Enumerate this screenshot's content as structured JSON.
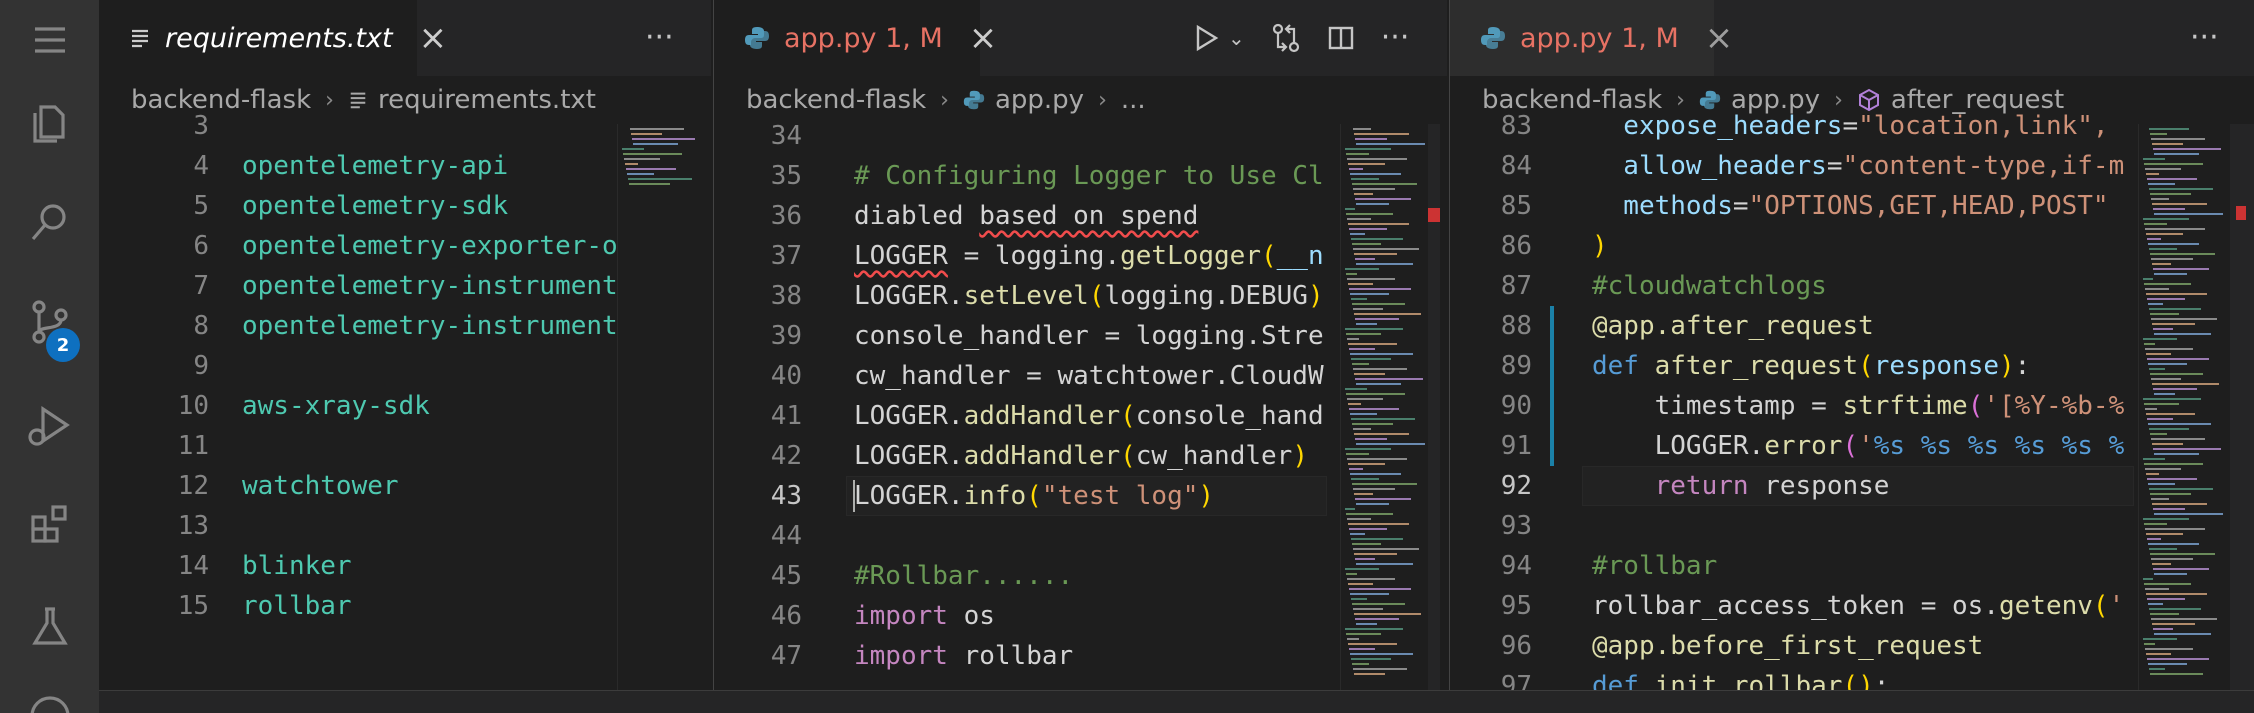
{
  "activity": {
    "items": [
      "explorer-icon",
      "search-icon",
      "source-control-icon",
      "run-debug-icon",
      "extensions-icon",
      "testing-icon"
    ],
    "scm_badge": "2"
  },
  "group1": {
    "tab_label": "requirements.txt",
    "breadcrumb": [
      "backend-flask",
      "requirements.txt"
    ],
    "lines": [
      {
        "n": "3",
        "t": ""
      },
      {
        "n": "4",
        "t": "opentelemetry-api"
      },
      {
        "n": "5",
        "t": "opentelemetry-sdk"
      },
      {
        "n": "6",
        "t": "opentelemetry-exporter-o"
      },
      {
        "n": "7",
        "t": "opentelemetry-instrument"
      },
      {
        "n": "8",
        "t": "opentelemetry-instrument"
      },
      {
        "n": "9",
        "t": ""
      },
      {
        "n": "10",
        "t": "aws-xray-sdk"
      },
      {
        "n": "11",
        "t": ""
      },
      {
        "n": "12",
        "t": "watchtower"
      },
      {
        "n": "13",
        "t": ""
      },
      {
        "n": "14",
        "t": "blinker"
      },
      {
        "n": "15",
        "t": "rollbar"
      }
    ]
  },
  "group2": {
    "tab_label": "app.py 1, M",
    "breadcrumb": [
      "backend-flask",
      "app.py",
      "..."
    ],
    "lines": [
      {
        "n": "34",
        "p": []
      },
      {
        "n": "35",
        "p": [
          {
            "c": "c-comment",
            "t": "# Configuring Logger to Use Cl"
          }
        ]
      },
      {
        "n": "36",
        "p": [
          {
            "c": "c-white",
            "t": "diabled "
          },
          {
            "c": "c-white squig",
            "t": "based on spend"
          }
        ]
      },
      {
        "n": "37",
        "p": [
          {
            "c": "c-white squig",
            "t": "LOGGER"
          },
          {
            "c": "c-white",
            "t": " = logging."
          },
          {
            "c": "c-fn",
            "t": "getLogger"
          },
          {
            "c": "c-yel",
            "t": "("
          },
          {
            "c": "c-var",
            "t": "__n"
          }
        ]
      },
      {
        "n": "38",
        "p": [
          {
            "c": "c-white",
            "t": "LOGGER."
          },
          {
            "c": "c-fn",
            "t": "setLevel"
          },
          {
            "c": "c-yel",
            "t": "("
          },
          {
            "c": "c-white",
            "t": "logging.DEBUG"
          },
          {
            "c": "c-yel",
            "t": ")"
          }
        ]
      },
      {
        "n": "39",
        "p": [
          {
            "c": "c-white",
            "t": "console_handler = logging.Stre"
          }
        ]
      },
      {
        "n": "40",
        "p": [
          {
            "c": "c-white",
            "t": "cw_handler = watchtower.CloudW"
          }
        ]
      },
      {
        "n": "41",
        "p": [
          {
            "c": "c-white",
            "t": "LOGGER."
          },
          {
            "c": "c-fn",
            "t": "addHandler"
          },
          {
            "c": "c-yel",
            "t": "("
          },
          {
            "c": "c-white",
            "t": "console_hand"
          }
        ]
      },
      {
        "n": "42",
        "p": [
          {
            "c": "c-white",
            "t": "LOGGER."
          },
          {
            "c": "c-fn",
            "t": "addHandler"
          },
          {
            "c": "c-yel",
            "t": "("
          },
          {
            "c": "c-white",
            "t": "cw_handler"
          },
          {
            "c": "c-yel",
            "t": ")"
          }
        ]
      },
      {
        "n": "43",
        "p": [
          {
            "c": "c-white",
            "t": "LOGGER."
          },
          {
            "c": "c-fn",
            "t": "info"
          },
          {
            "c": "c-yel",
            "t": "("
          },
          {
            "c": "c-str",
            "t": "\"test log\""
          },
          {
            "c": "c-yel",
            "t": ")"
          }
        ]
      },
      {
        "n": "44",
        "p": []
      },
      {
        "n": "45",
        "p": [
          {
            "c": "c-comment",
            "t": "#Rollbar......"
          }
        ]
      },
      {
        "n": "46",
        "p": [
          {
            "c": "c-kw",
            "t": "import"
          },
          {
            "c": "c-white",
            "t": " os"
          }
        ]
      },
      {
        "n": "47",
        "p": [
          {
            "c": "c-kw",
            "t": "import"
          },
          {
            "c": "c-white",
            "t": " rollbar"
          }
        ]
      }
    ]
  },
  "group3": {
    "tab_label": "app.py 1, M",
    "breadcrumb": [
      "backend-flask",
      "app.py",
      "after_request"
    ],
    "lines": [
      {
        "n": "83",
        "p": [
          {
            "c": "c-var",
            "t": "  expose_headers"
          },
          {
            "c": "c-white",
            "t": "="
          },
          {
            "c": "c-str",
            "t": "\"location,link\","
          }
        ]
      },
      {
        "n": "84",
        "p": [
          {
            "c": "c-var",
            "t": "  allow_headers"
          },
          {
            "c": "c-white",
            "t": "="
          },
          {
            "c": "c-str",
            "t": "\"content-type,if-m"
          }
        ]
      },
      {
        "n": "85",
        "p": [
          {
            "c": "c-var",
            "t": "  methods"
          },
          {
            "c": "c-white",
            "t": "="
          },
          {
            "c": "c-str",
            "t": "\"OPTIONS,GET,HEAD,POST\""
          }
        ]
      },
      {
        "n": "86",
        "p": [
          {
            "c": "c-yel",
            "t": ")"
          }
        ]
      },
      {
        "n": "87",
        "p": [
          {
            "c": "c-comment",
            "t": "#cloudwatchlogs"
          }
        ]
      },
      {
        "n": "88",
        "p": [
          {
            "c": "c-fn",
            "t": "@app.after_request"
          }
        ]
      },
      {
        "n": "89",
        "p": [
          {
            "c": "c-blue",
            "t": "def"
          },
          {
            "c": "c-white",
            "t": " "
          },
          {
            "c": "c-fn",
            "t": "after_request"
          },
          {
            "c": "c-yel",
            "t": "("
          },
          {
            "c": "c-var",
            "t": "response"
          },
          {
            "c": "c-yel",
            "t": ")"
          },
          {
            "c": "c-white",
            "t": ":"
          }
        ]
      },
      {
        "n": "90",
        "p": [
          {
            "c": "c-white",
            "t": "    timestamp = "
          },
          {
            "c": "c-fn",
            "t": "strftime"
          },
          {
            "c": "c-pur",
            "t": "("
          },
          {
            "c": "c-str",
            "t": "'[%Y-%b-%"
          }
        ]
      },
      {
        "n": "91",
        "p": [
          {
            "c": "c-white",
            "t": "    LOGGER."
          },
          {
            "c": "c-fn",
            "t": "error"
          },
          {
            "c": "c-pur",
            "t": "("
          },
          {
            "c": "c-str",
            "t": "'"
          },
          {
            "c": "c-esc",
            "t": "%s %s %s %s %s %"
          }
        ]
      },
      {
        "n": "92",
        "p": [
          {
            "c": "c-kw",
            "t": "    return"
          },
          {
            "c": "c-white",
            "t": " response"
          }
        ]
      },
      {
        "n": "93",
        "p": []
      },
      {
        "n": "94",
        "p": [
          {
            "c": "c-comment",
            "t": "#rollbar"
          }
        ]
      },
      {
        "n": "95",
        "p": [
          {
            "c": "c-white",
            "t": "rollbar_access_token = os."
          },
          {
            "c": "c-fn",
            "t": "getenv"
          },
          {
            "c": "c-yel",
            "t": "("
          },
          {
            "c": "c-str",
            "t": "'"
          }
        ]
      },
      {
        "n": "96",
        "p": [
          {
            "c": "c-fn",
            "t": "@app.before_first_request"
          }
        ]
      },
      {
        "n": "97",
        "p": [
          {
            "c": "c-blue",
            "t": "def"
          },
          {
            "c": "c-white",
            "t": " "
          },
          {
            "c": "c-fn",
            "t": "init_rollbar"
          },
          {
            "c": "c-yel",
            "t": "()"
          },
          {
            "c": "c-white",
            "t": ":"
          }
        ]
      }
    ]
  }
}
